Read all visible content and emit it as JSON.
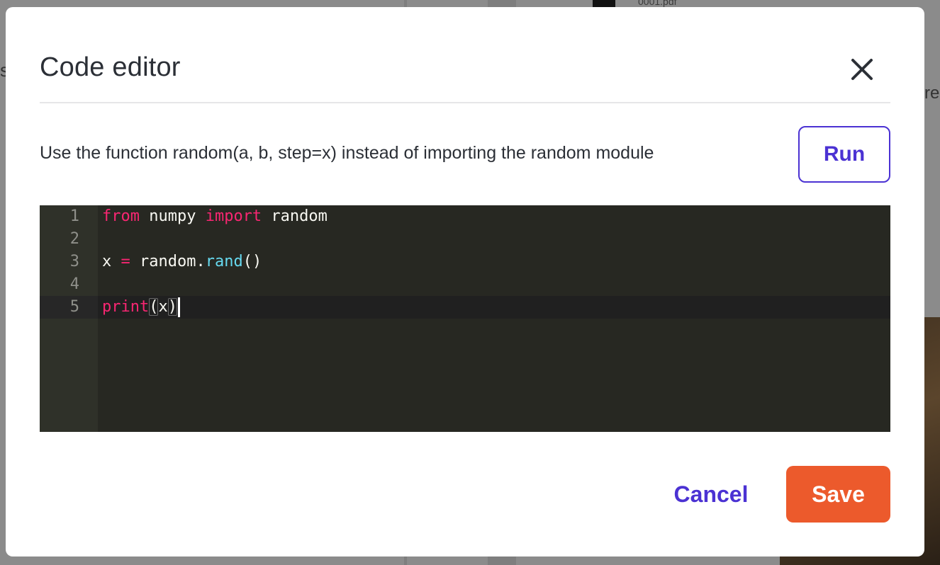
{
  "background": {
    "file_label": "0001.pdf",
    "left_fragment": "st",
    "right_fragment": "ren"
  },
  "modal": {
    "title": "Code editor",
    "close_icon": "close-icon",
    "hint": "Use the function random(a, b, step=x) instead of importing the random module",
    "run_label": "Run",
    "cancel_label": "Cancel",
    "save_label": "Save"
  },
  "editor": {
    "theme": "dark",
    "active_line": 5,
    "lines": [
      {
        "number": "1",
        "text": "from numpy import random"
      },
      {
        "number": "2",
        "text": ""
      },
      {
        "number": "3",
        "text": "x = random.rand()"
      },
      {
        "number": "4",
        "text": ""
      },
      {
        "number": "5",
        "text": "print(x)"
      }
    ]
  },
  "colors": {
    "accent": "#4b32d3",
    "save": "#ec5a2c",
    "editor_bg": "#272822",
    "keyword": "#f92672",
    "function": "#66d9ef"
  }
}
